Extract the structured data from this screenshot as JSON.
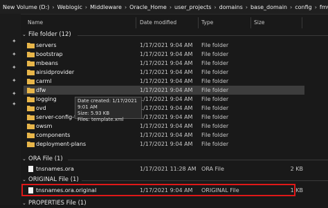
{
  "breadcrumb": [
    "New Volume (D:)",
    "Weblogic",
    "Middleware",
    "Oracle_Home",
    "user_projects",
    "domains",
    "base_domain",
    "config",
    "fmwconfig"
  ],
  "columns": {
    "name": "Name",
    "date": "Date modified",
    "type": "Type",
    "size": "Size"
  },
  "groups": {
    "folder": {
      "title": "File folder (12)"
    },
    "ora": {
      "title": "ORA File (1)"
    },
    "original": {
      "title": "ORIGINAL File (1)"
    },
    "properties": {
      "title": "PROPERTIES File (1)"
    }
  },
  "folders": [
    {
      "name": "servers",
      "date": "1/17/2021 9:04 AM",
      "type": "File folder"
    },
    {
      "name": "bootstrap",
      "date": "1/17/2021 9:04 AM",
      "type": "File folder"
    },
    {
      "name": "mbeans",
      "date": "1/17/2021 9:04 AM",
      "type": "File folder"
    },
    {
      "name": "airsidprovider",
      "date": "1/17/2021 9:04 AM",
      "type": "File folder"
    },
    {
      "name": "carml",
      "date": "1/17/2021 9:04 AM",
      "type": "File folder"
    },
    {
      "name": "dfw",
      "date": "1/17/2021 9:04 AM",
      "type": "File folder"
    },
    {
      "name": "logging",
      "date": "1/17/2021 9:04 AM",
      "type": "File folder"
    },
    {
      "name": "ovd",
      "date": "1/17/2021 9:04 AM",
      "type": "File folder"
    },
    {
      "name": "server-config-template",
      "date": "1/17/2021 9:04 AM",
      "type": "File folder"
    },
    {
      "name": "owsm",
      "date": "1/17/2021 9:04 AM",
      "type": "File folder"
    },
    {
      "name": "components",
      "date": "1/17/2021 9:04 AM",
      "type": "File folder"
    },
    {
      "name": "deployment-plans",
      "date": "1/17/2021 9:04 AM",
      "type": "File folder"
    }
  ],
  "ora_file": {
    "name": "tnsnames.ora",
    "date": "1/17/2021 11:28 AM",
    "type": "ORA File",
    "size": "2 KB"
  },
  "original_file": {
    "name": "tnsnames.ora.original",
    "date": "1/17/2021 9:04 AM",
    "type": "ORIGINAL File",
    "size": "1 KB"
  },
  "tooltip": {
    "line1": "Date created: 1/17/2021 9:01 AM",
    "line2": "Size: 5.93 KB",
    "line3": "Files: template.xml"
  },
  "icons": {
    "pin": "pin-icon",
    "folder": "folder-icon",
    "file": "file-icon",
    "chevron": "chevron-down-icon"
  },
  "colors": {
    "folder": "#e8b64a",
    "selection": "#3d3d3d",
    "highlight": "#e01818"
  }
}
